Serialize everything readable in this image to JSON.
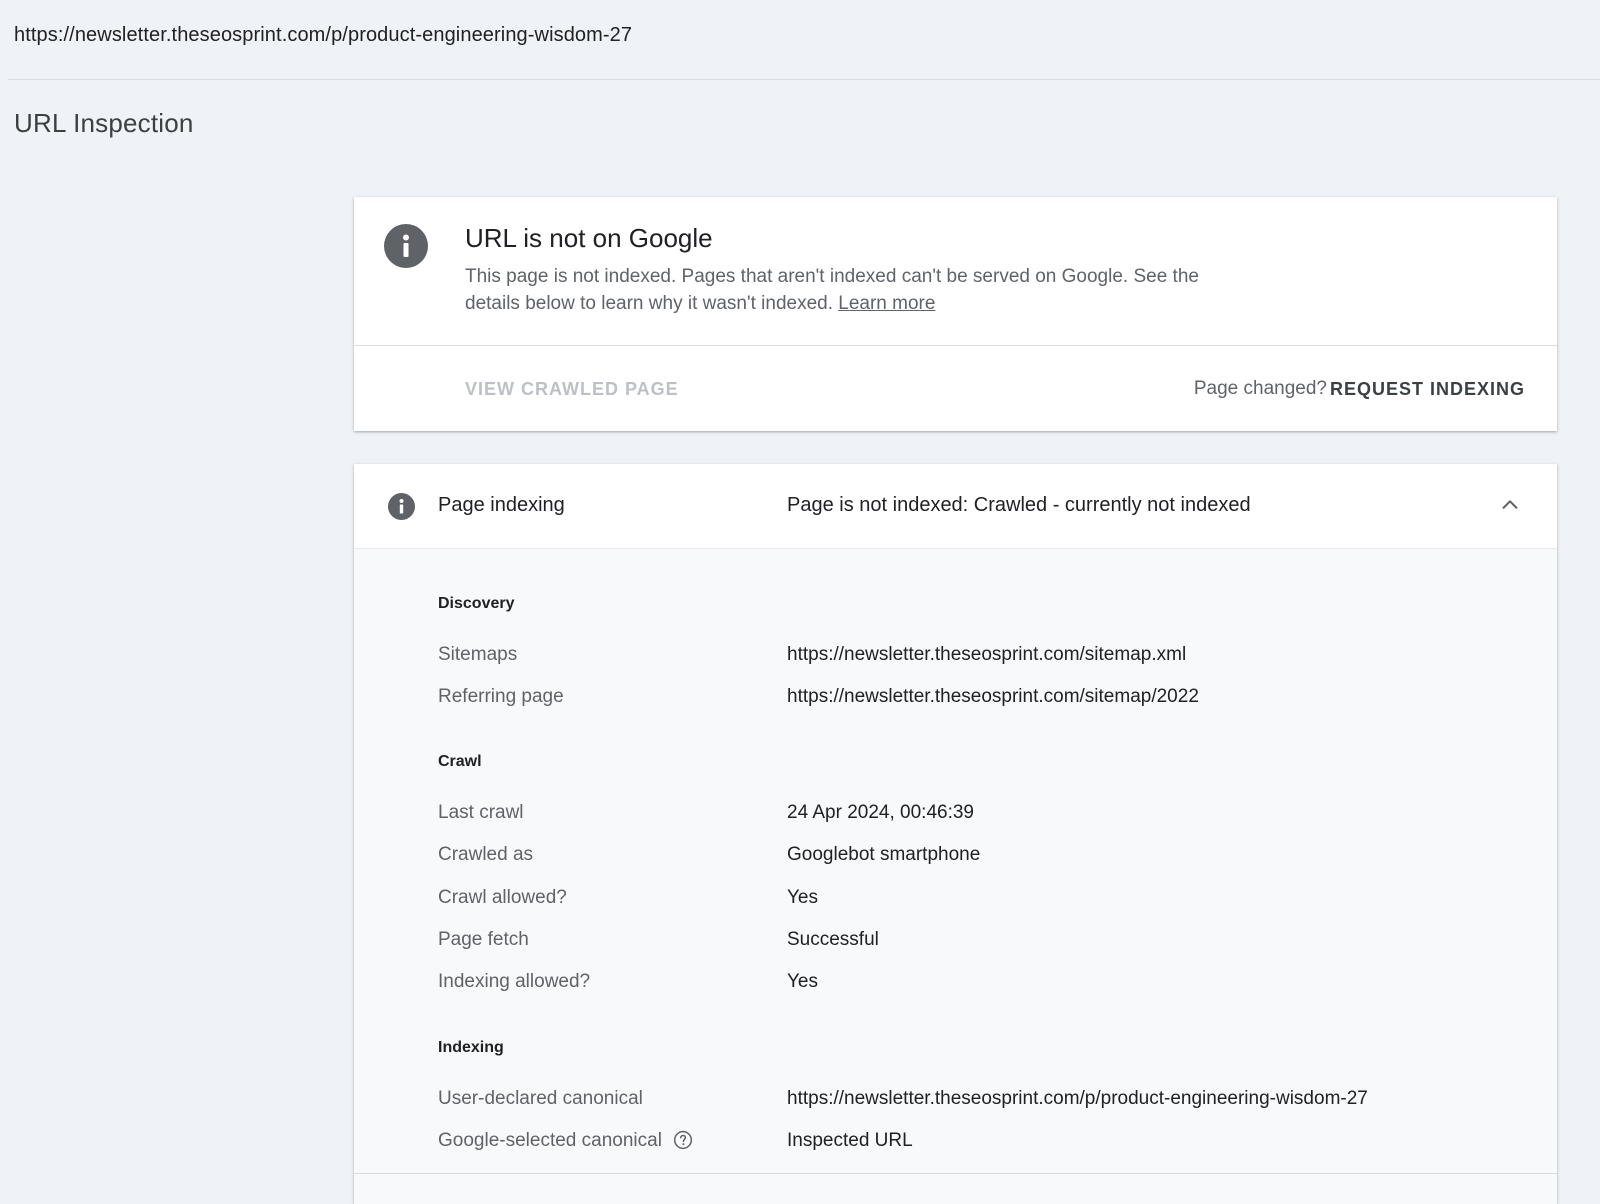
{
  "address_bar": {
    "url": "https://newsletter.theseosprint.com/p/product-engineering-wisdom-27"
  },
  "page": {
    "title": "URL Inspection"
  },
  "status_card": {
    "icon": "info-icon",
    "title": "URL is not on Google",
    "description": "This page is not indexed. Pages that aren't indexed can't be served on Google. See the details below to learn why it wasn't indexed.",
    "learn_more": "Learn more",
    "view_crawled_page": "VIEW CRAWLED PAGE",
    "page_changed": "Page changed?",
    "request_indexing": "REQUEST INDEXING"
  },
  "indexing_card": {
    "icon": "info-icon",
    "label": "Page indexing",
    "value": "Page is not indexed: Crawled - currently not indexed",
    "toggle_icon": "chevron-up-icon",
    "discovery": {
      "heading": "Discovery",
      "sitemaps_label": "Sitemaps",
      "sitemaps_value": "https://newsletter.theseosprint.com/sitemap.xml",
      "referring_label": "Referring page",
      "referring_value": "https://newsletter.theseosprint.com/sitemap/2022"
    },
    "crawl": {
      "heading": "Crawl",
      "last_crawl_label": "Last crawl",
      "last_crawl_value": "24 Apr 2024, 00:46:39",
      "crawled_as_label": "Crawled as",
      "crawled_as_value": "Googlebot smartphone",
      "crawl_allowed_label": "Crawl allowed?",
      "crawl_allowed_value": "Yes",
      "page_fetch_label": "Page fetch",
      "page_fetch_value": "Successful",
      "indexing_allowed_label": "Indexing allowed?",
      "indexing_allowed_value": "Yes"
    },
    "indexing": {
      "heading": "Indexing",
      "user_canonical_label": "User-declared canonical",
      "user_canonical_value": "https://newsletter.theseosprint.com/p/product-engineering-wisdom-27",
      "google_canonical_label": "Google-selected canonical",
      "google_canonical_value": "Inspected URL",
      "help_icon": "help-circle-icon"
    }
  }
}
